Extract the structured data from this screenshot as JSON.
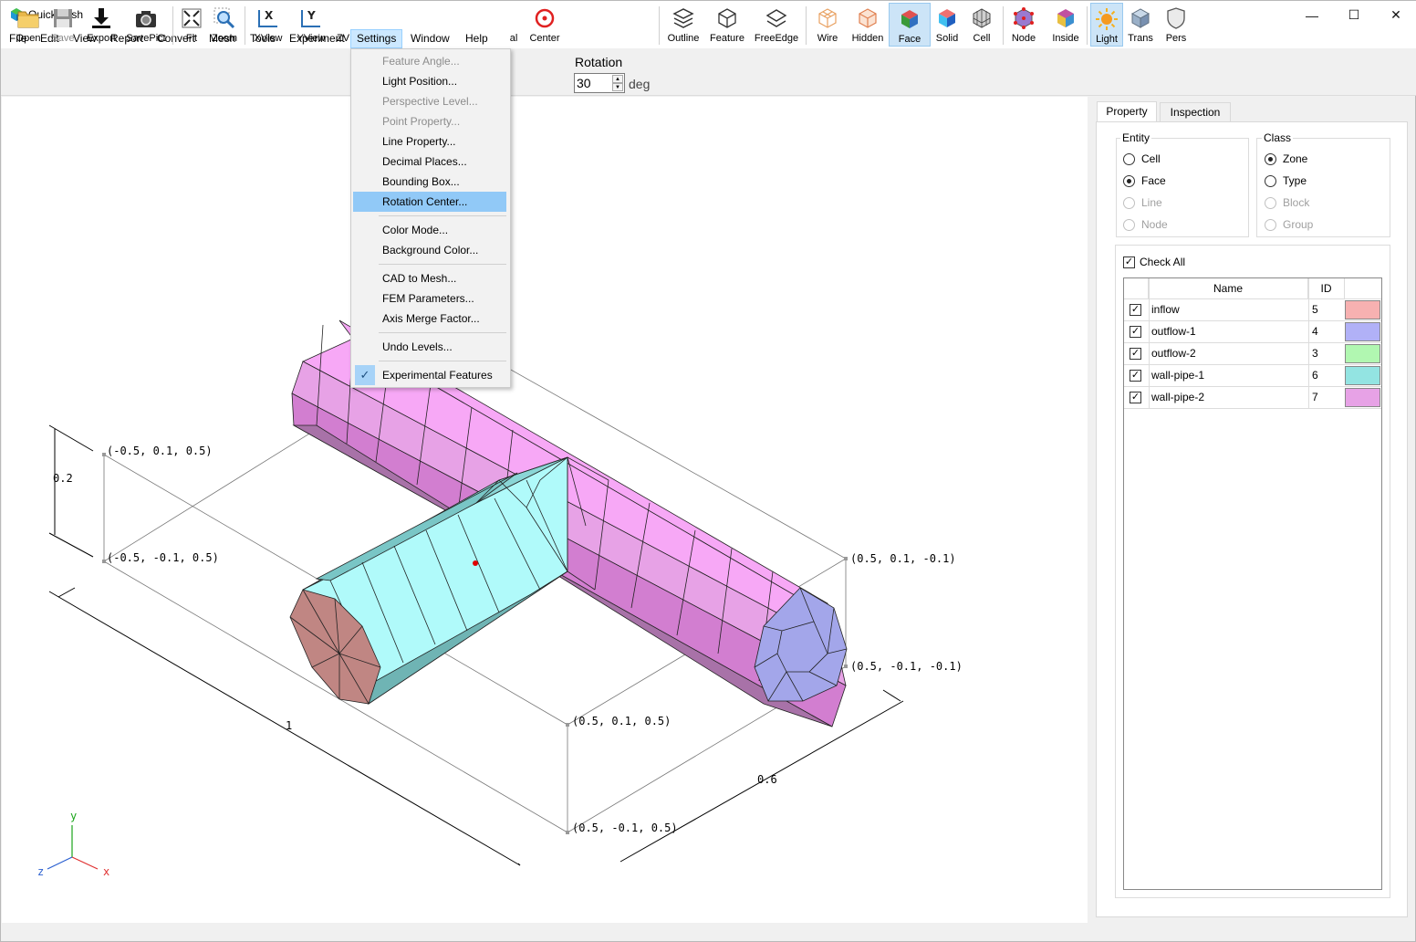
{
  "window": {
    "title": "QuickMesh",
    "minimize": "—",
    "maximize": "☐",
    "close": "✕"
  },
  "menubar": [
    "File",
    "Edit",
    "View",
    "Report",
    "Convert",
    "Mesh",
    "Tools",
    "Experiment",
    "Settings",
    "Window",
    "Help"
  ],
  "toolbar": {
    "open": "Open",
    "save": "Save",
    "export": "Export",
    "savepict": "SavePict",
    "fit": "Fit",
    "zoom": "Zoom",
    "xview": "XView",
    "yview": "YView",
    "zview": "ZV",
    "normal": "al",
    "center": "Center",
    "rotation_label": "Rotation",
    "rotation_value": "30",
    "rotation_unit": "deg",
    "outline": "Outline",
    "feature": "Feature",
    "freeedge": "FreeEdge",
    "wire": "Wire",
    "hidden": "Hidden",
    "face": "Face",
    "solid": "Solid",
    "cell": "Cell",
    "node": "Node",
    "inside": "Inside",
    "light": "Light",
    "trans": "Trans",
    "pers": "Pers"
  },
  "settings_menu": {
    "feature_angle": "Feature Angle...",
    "light_position": "Light Position...",
    "perspective_level": "Perspective Level...",
    "point_property": "Point Property...",
    "line_property": "Line Property...",
    "decimal_places": "Decimal Places...",
    "bounding_box": "Bounding Box...",
    "rotation_center": "Rotation Center...",
    "color_mode": "Color Mode...",
    "background_color": "Background Color...",
    "cad_to_mesh": "CAD to Mesh...",
    "fem_parameters": "FEM Parameters...",
    "axis_merge_factor": "Axis Merge Factor...",
    "undo_levels": "Undo Levels...",
    "experimental_features": "Experimental Features"
  },
  "viewport": {
    "labels": {
      "c1": "(-0.5, 0.1, 0.5)",
      "c2": "(-0.5, -0.1, 0.5)",
      "c3": "(0.5, 0.1, -0.1)",
      "c4": "(0.5, -0.1, -0.1)",
      "c5": "(0.5, 0.1, 0.5)",
      "c6": "(0.5, -0.1, 0.5)",
      "dim_y": "0.2",
      "dim_x": "1",
      "dim_z": "0.6"
    },
    "axes": {
      "x": "x",
      "y": "y",
      "z": "z"
    },
    "colors": {
      "inflow": "#c08683",
      "wall1": "#b0fafa",
      "wall2": "#f7a8f6",
      "outflow": "#a3a6ea"
    }
  },
  "panel": {
    "tabs": [
      "Property",
      "Inspection"
    ],
    "entity": {
      "title": "Entity",
      "options": [
        "Cell",
        "Face",
        "Line",
        "Node"
      ]
    },
    "class": {
      "title": "Class",
      "options": [
        "Zone",
        "Type",
        "Block",
        "Group"
      ]
    },
    "check_all": "Check All",
    "columns": {
      "name": "Name",
      "id": "ID"
    },
    "zones": [
      {
        "name": "inflow",
        "id": "5",
        "color": "#f7b1b1"
      },
      {
        "name": "outflow-1",
        "id": "4",
        "color": "#b1b1f7"
      },
      {
        "name": "outflow-2",
        "id": "3",
        "color": "#b1f7b1"
      },
      {
        "name": "wall-pipe-1",
        "id": "6",
        "color": "#93e4e2"
      },
      {
        "name": "wall-pipe-2",
        "id": "7",
        "color": "#e7a2e6"
      }
    ]
  }
}
